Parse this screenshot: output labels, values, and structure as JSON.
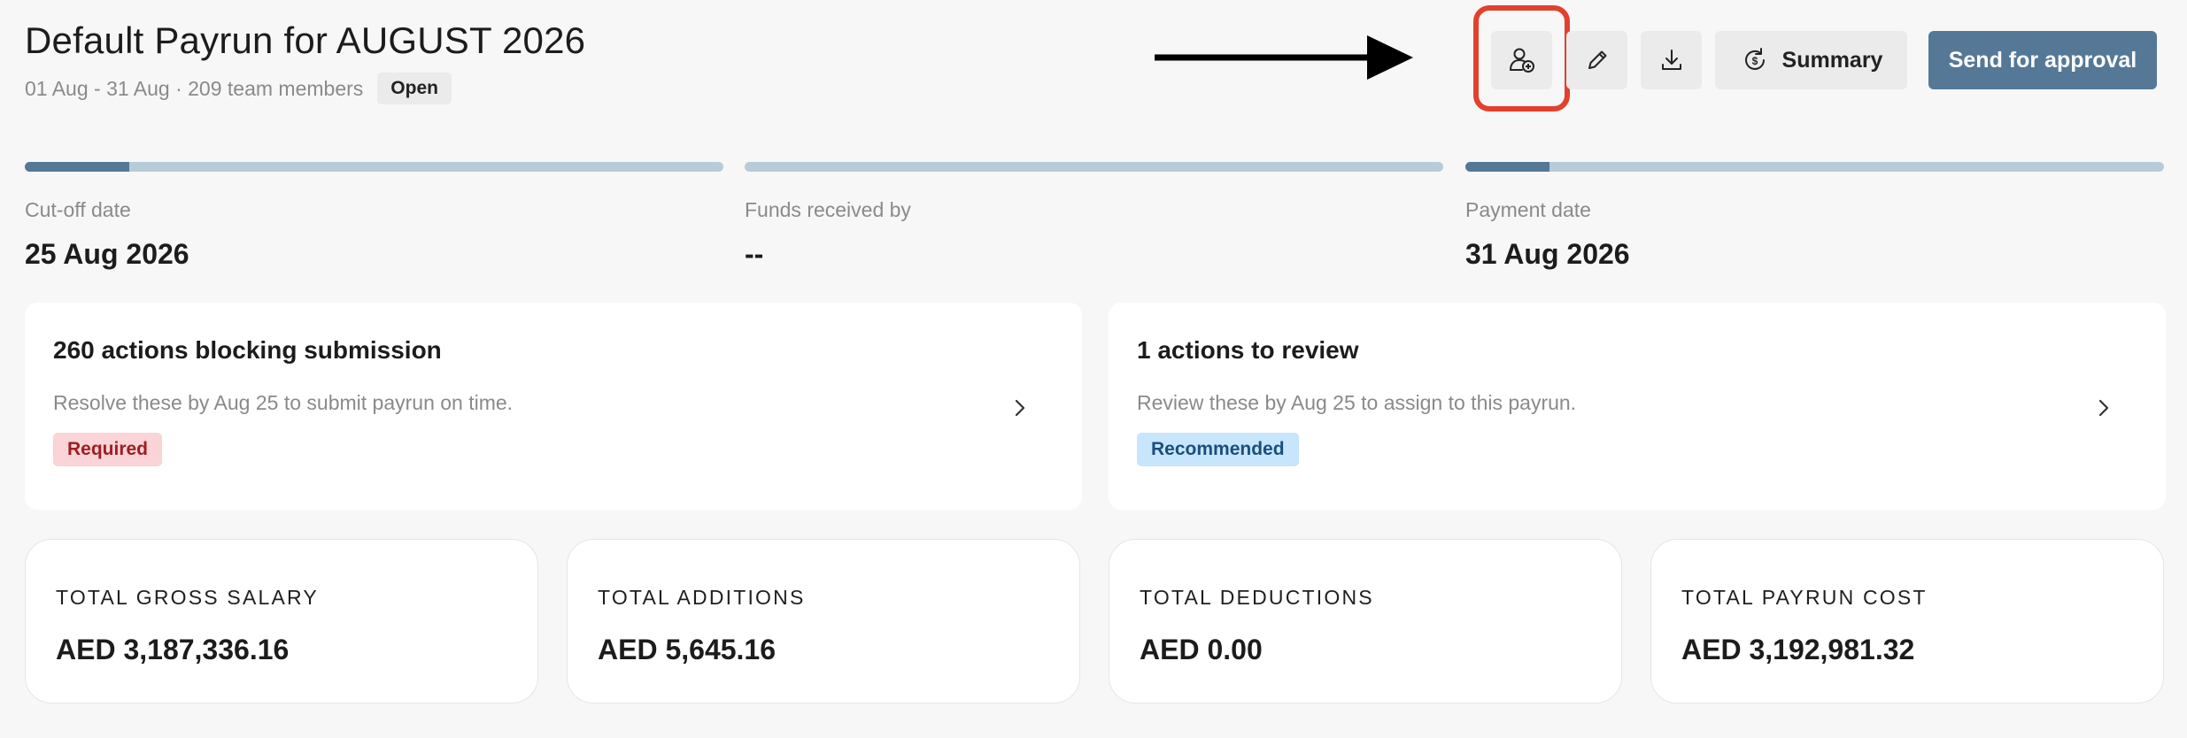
{
  "header": {
    "title": "Default Payrun for AUGUST 2026",
    "subtitle": "01 Aug - 31 Aug · 209 team members",
    "status": "Open"
  },
  "toolbar": {
    "add_member_icon": "user-plus-icon",
    "edit_icon": "pencil-icon",
    "download_icon": "download-icon",
    "summary_label": "Summary",
    "summary_icon": "currency-refresh-icon",
    "approval_label": "Send for approval"
  },
  "milestones": [
    {
      "label": "Cut-off date",
      "value": "25 Aug 2026",
      "progress": 0.15
    },
    {
      "label": "Funds received by",
      "value": "--",
      "progress": 0
    },
    {
      "label": "Payment date",
      "value": "31 Aug 2026",
      "progress": 0.12
    }
  ],
  "actions": [
    {
      "title": "260 actions blocking submission",
      "description": "Resolve these by Aug 25 to submit payrun on time.",
      "tag": "Required"
    },
    {
      "title": "1 actions to review",
      "description": "Review these by Aug 25 to assign to this payrun.",
      "tag": "Recommended"
    }
  ],
  "totals": [
    {
      "label": "TOTAL GROSS SALARY",
      "value": "AED 3,187,336.16"
    },
    {
      "label": "TOTAL ADDITIONS",
      "value": "AED 5,645.16"
    },
    {
      "label": "TOTAL DEDUCTIONS",
      "value": "AED 0.00"
    },
    {
      "label": "TOTAL PAYRUN COST",
      "value": "AED 3,192,981.32"
    }
  ],
  "colors": {
    "accent": "#557896",
    "progress_track": "#b7cbd9",
    "highlight": "#e1412d",
    "required_bg": "#fad4d6",
    "recommended_bg": "#c7e6fb"
  }
}
